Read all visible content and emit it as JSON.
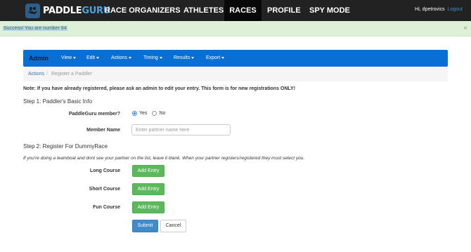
{
  "brand": {
    "logo_text_a": "PADDLE",
    "logo_text_b": "GURU"
  },
  "topnav": {
    "items": [
      "RACE ORGANIZERS",
      "ATHLETES",
      "RACES",
      "PROFILE",
      "SPY MODE"
    ],
    "active": "RACES",
    "greeting": "Hi, dpetrovics",
    "logout": "Logout"
  },
  "alert": {
    "message": "Success! You are number 94",
    "close": "×"
  },
  "admin_bar": {
    "brand": "Admin",
    "menus": [
      "View",
      "Edit",
      "Actions",
      "Timing",
      "Results",
      "Export"
    ]
  },
  "breadcrumb": {
    "link": "Actions",
    "separator": "/",
    "current": "Register a Paddler"
  },
  "form": {
    "note": "Note: If you have already registered, please ask an admin to edit your entry. This form is for new registrations ONLY!",
    "step1": "Step 1: Paddler's Basic Info",
    "member_label": "PaddleGuru member?",
    "member_options": [
      "Yes",
      "No"
    ],
    "member_selected": "Yes",
    "member_name_label": "Member Name",
    "member_name_placeholder": "Enter partner name here",
    "member_name_value": "",
    "step2": "Step 2: Register For DummyRace",
    "teamboat_note": "If you're doing a teamboat and dont see your partner on the list, leave it blank. When your partner registers/registered they must select you.",
    "courses": [
      {
        "label": "Long Course",
        "button": "Add Entry"
      },
      {
        "label": "Short Course",
        "button": "Add Entry"
      },
      {
        "label": "Fun Course",
        "button": "Add Entry"
      }
    ],
    "submit": "Submit",
    "cancel": "Cancel"
  },
  "colors": {
    "topnav_bg": "#222222",
    "admin_bar_bg": "#0a6fd4",
    "alert_bg": "#dff0d8",
    "success_button": "#5cb85c",
    "primary_button": "#428bca"
  },
  "icons": {
    "logo": "paddle-boat-logo-icon",
    "close": "close-icon",
    "dropdown": "caret-down-icon"
  }
}
